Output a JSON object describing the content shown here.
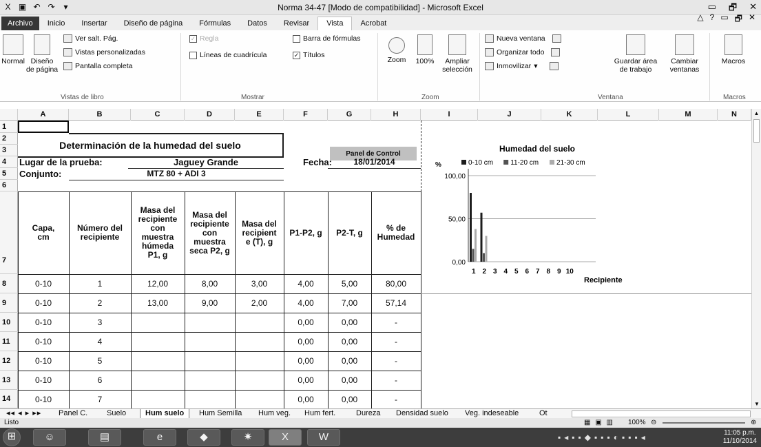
{
  "window": {
    "title": "Norma 34-47  [Modo de compatibilidad]  -  Microsoft Excel",
    "controls": [
      "▭",
      "🗗",
      "✕"
    ]
  },
  "ribbon_tabs": [
    "Archivo",
    "Inicio",
    "Insertar",
    "Diseño de página",
    "Fórmulas",
    "Datos",
    "Revisar",
    "Vista",
    "Acrobat"
  ],
  "active_tab": "Vista",
  "ribbon": {
    "vistas": {
      "normal": "Normal",
      "diseno": "Diseño\nde página",
      "ver_salt": "Ver salt. Pág.",
      "personalizadas": "Vistas personalizadas",
      "pantalla": "Pantalla completa",
      "label": "Vistas de libro"
    },
    "mostrar": {
      "regla": "Regla",
      "lineas": "Líneas de cuadrícula",
      "barra": "Barra de fórmulas",
      "titulos": "Títulos",
      "label": "Mostrar"
    },
    "zoom": {
      "zoom": "Zoom",
      "pct": "100%",
      "ampliar": "Ampliar\nselección",
      "label": "Zoom"
    },
    "ventana": {
      "nueva": "Nueva ventana",
      "organizar": "Organizar todo",
      "inmovilizar": "Inmovilizar",
      "guardar": "Guardar área\nde trabajo",
      "cambiar": "Cambiar\nventanas",
      "label": "Ventana"
    },
    "macros": {
      "macros": "Macros",
      "label": "Macros"
    }
  },
  "columns": [
    "A",
    "B",
    "C",
    "D",
    "E",
    "F",
    "G",
    "H",
    "I",
    "J",
    "K",
    "L",
    "M",
    "N"
  ],
  "rows": [
    "1",
    "2",
    "3",
    "4",
    "5",
    "6",
    "7",
    "8",
    "9",
    "10",
    "11",
    "12",
    "13",
    "14"
  ],
  "sheet": {
    "title": "Determinación de la humedad del suelo",
    "panel": "Panel de Control",
    "lugar_label": "Lugar de la prueba:",
    "lugar_value": "Jaguey Grande",
    "fecha_label": "Fecha:",
    "fecha_value": "18/01/2014",
    "conjunto_label": "Conjunto:",
    "conjunto_value": "MTZ 80 + ADI 3",
    "headers": [
      "Capa,\ncm",
      "Número del\nrecipiente",
      "Masa del\nrecipiente\ncon\nmuestra\nhúmeda\nP1, g",
      "Masa del\nrecipiente\ncon\nmuestra\nseca P2, g",
      "Masa del\nrecipient\ne (T), g",
      "P1-P2, g",
      "P2-T, g",
      "% de\nHumedad"
    ],
    "data": [
      [
        "0-10",
        "1",
        "12,00",
        "8,00",
        "3,00",
        "4,00",
        "5,00",
        "80,00"
      ],
      [
        "0-10",
        "2",
        "13,00",
        "9,00",
        "2,00",
        "4,00",
        "7,00",
        "57,14"
      ],
      [
        "0-10",
        "3",
        "",
        "",
        "",
        "0,00",
        "0,00",
        "-"
      ],
      [
        "0-10",
        "4",
        "",
        "",
        "",
        "0,00",
        "0,00",
        "-"
      ],
      [
        "0-10",
        "5",
        "",
        "",
        "",
        "0,00",
        "0,00",
        "-"
      ],
      [
        "0-10",
        "6",
        "",
        "",
        "",
        "0,00",
        "0,00",
        "-"
      ],
      [
        "0-10",
        "7",
        "",
        "",
        "",
        "0,00",
        "0,00",
        "-"
      ]
    ]
  },
  "chart_data": {
    "type": "bar",
    "title": "Humedad del suelo",
    "ylabel": "%",
    "xlabel": "Recipiente",
    "categories": [
      "1",
      "2",
      "3",
      "4",
      "5",
      "6",
      "7",
      "8",
      "9",
      "10"
    ],
    "ylim": [
      0,
      100
    ],
    "yticks": [
      "0,00",
      "50,00",
      "100,00"
    ],
    "series": [
      {
        "name": "0-10 cm",
        "values": [
          80,
          57,
          0,
          0,
          0,
          0,
          0,
          0,
          0,
          0
        ],
        "color": "#222222"
      },
      {
        "name": "11-20 cm",
        "values": [
          15,
          10,
          0,
          0,
          0,
          0,
          0,
          0,
          0,
          0
        ],
        "color": "#555555"
      },
      {
        "name": "21-30 cm",
        "values": [
          38,
          30,
          0,
          0,
          0,
          0,
          0,
          0,
          0,
          0
        ],
        "color": "#aaaaaa"
      }
    ],
    "legend": "top"
  },
  "sheet_tabs": [
    "Panel C.",
    "Suelo",
    "Hum suelo",
    "Hum Semilla",
    "Hum veg.",
    "Hum fert.",
    "Dureza",
    "Densidad suelo",
    "Veg. indeseable",
    "Ot"
  ],
  "active_sheet": "Hum suelo",
  "status": {
    "ready": "Listo",
    "zoom": "100%"
  },
  "clock": {
    "time": "11:05 p.m.",
    "date": "11/10/2014"
  }
}
